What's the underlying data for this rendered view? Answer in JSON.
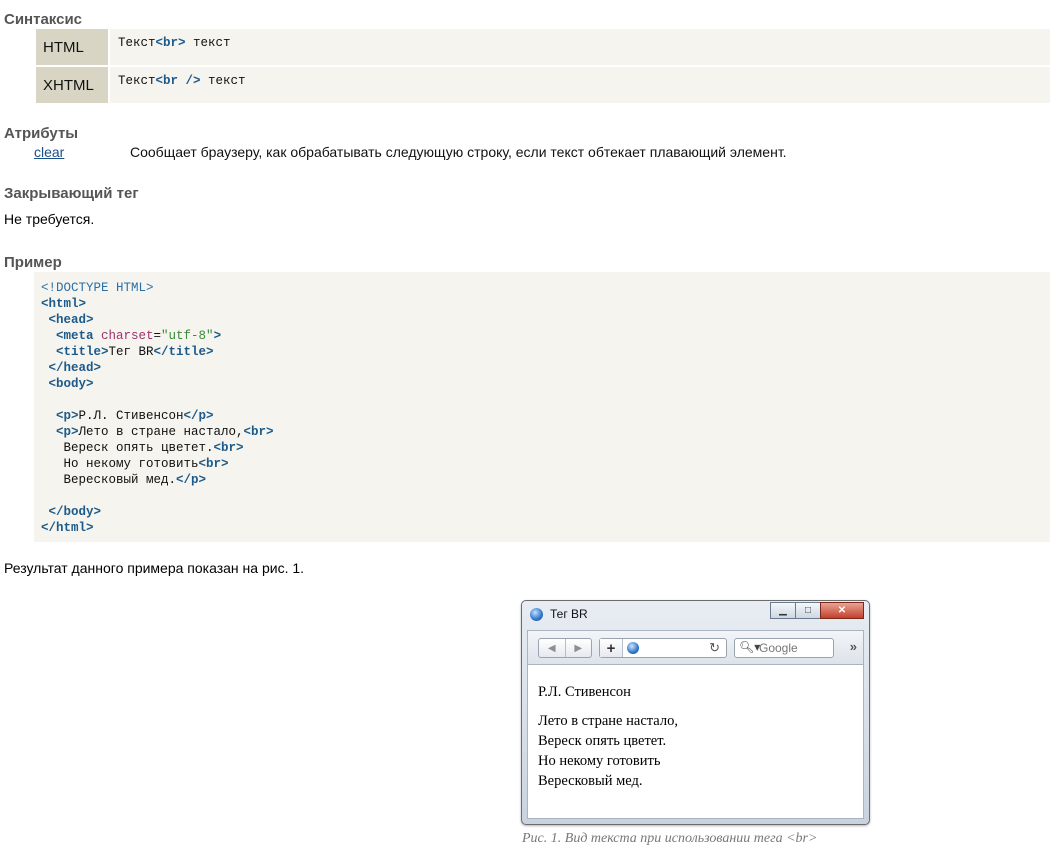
{
  "syntax": {
    "heading": "Синтаксис",
    "rows": [
      {
        "label": "HTML",
        "pre": "Текст",
        "tag": "<br>",
        "post": " текст"
      },
      {
        "label": "XHTML",
        "pre": "Текст",
        "tag": "<br />",
        "post": " текст"
      }
    ]
  },
  "attributes": {
    "heading": "Атрибуты",
    "items": [
      {
        "name": "clear",
        "description": "Сообщает браузеру, как обрабатывать следующую строку, если текст обтекает плавающий элемент."
      }
    ]
  },
  "closing_tag": {
    "heading": "Закрывающий тег",
    "text": "Не требуется."
  },
  "example": {
    "heading": "Пример",
    "lines": {
      "l1": "<!DOCTYPE HTML>",
      "l2": "<html>",
      "l3": " <head>",
      "l4a": "  <meta ",
      "l4b": "charset",
      "l4c": "=",
      "l4d": "\"utf-8\"",
      "l4e": ">",
      "l5a": "  <title>",
      "l5b": "Тег BR",
      "l5c": "</title>",
      "l6": " </head>",
      "l7": " <body>",
      "l9a": "  <p>",
      "l9b": "Р.Л. Стивенсон",
      "l9c": "</p>",
      "l10a": "  <p>",
      "l10b": "Лето в стране настало,",
      "l10c": "<br>",
      "l11a": "   Вереск опять цветет.",
      "l11b": "<br>",
      "l12a": "   Но некому готовить",
      "l12b": "<br>",
      "l13a": "   Вересковый мед.",
      "l13b": "</p>",
      "l15": " </body>",
      "l16": "</html>"
    }
  },
  "result": {
    "text": "Результат данного примера показан на рис. 1."
  },
  "browser": {
    "title": "Тег BR",
    "search_placeholder": "Google",
    "minimize": "▁",
    "maximize": "□",
    "close": "✕",
    "back": "◀",
    "forward": "▶",
    "plus": "+",
    "reload": "↻",
    "search_icon": "🔍︎▾",
    "more": "»",
    "content": {
      "p1": "Р.Л. Стивенсон",
      "p2_lines": [
        "Лето в стране настало,",
        "Вереск опять цветет.",
        "Но некому готовить",
        "Вересковый мед."
      ]
    },
    "icons": [
      "globe-icon",
      "minimize-icon",
      "maximize-icon",
      "close-icon",
      "back-arrow-icon",
      "forward-arrow-icon",
      "plus-icon",
      "reload-icon",
      "search-icon",
      "chevron-right-icon"
    ]
  },
  "figure_caption": "Рис. 1. Вид текста при использовании тега <br>"
}
